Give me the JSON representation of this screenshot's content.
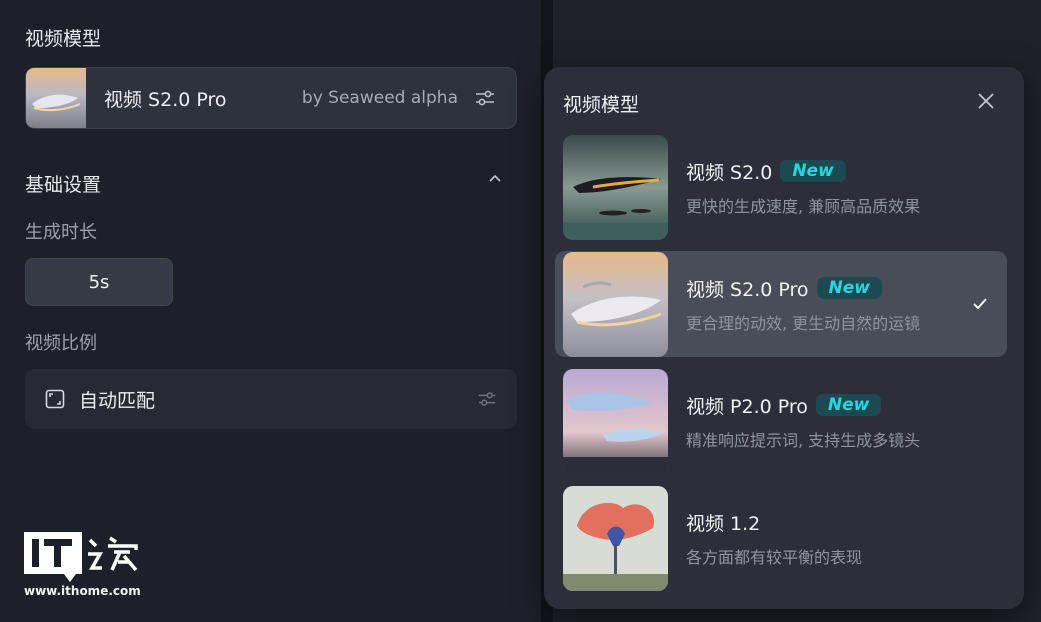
{
  "left": {
    "section_model_title": "视频模型",
    "selected_model": {
      "name": "视频 S2.0 Pro",
      "by": "by Seaweed alpha"
    },
    "basic_settings_title": "基础设置",
    "duration_label": "生成时长",
    "duration_value": "5s",
    "ratio_label": "视频比例",
    "ratio_value": "自动匹配"
  },
  "logo": {
    "text": "IT之家",
    "url": "www.ithome.com"
  },
  "popup": {
    "title": "视频模型",
    "items": [
      {
        "name": "视频 S2.0",
        "badge": "New",
        "desc": "更快的生成速度, 兼顾高品质效果",
        "selected": false
      },
      {
        "name": "视频 S2.0 Pro",
        "badge": "New",
        "desc": "更合理的动效, 更生动自然的运镜",
        "selected": true
      },
      {
        "name": "视频 P2.0 Pro",
        "badge": "New",
        "desc": "精准响应提示词, 支持生成多镜头",
        "selected": false
      },
      {
        "name": "视频 1.2",
        "badge": "",
        "desc": "各方面都有较平衡的表现",
        "selected": false
      }
    ]
  },
  "icons": {
    "adjust": "sliders-icon",
    "collapse": "chevron-up-icon",
    "close": "close-icon",
    "check": "check-icon",
    "ratio": "aspect-ratio-icon"
  },
  "colors": {
    "badge_text": "#2ad4dd",
    "badge_bg": "#1d4a52",
    "selected_bg": "#484d59"
  }
}
